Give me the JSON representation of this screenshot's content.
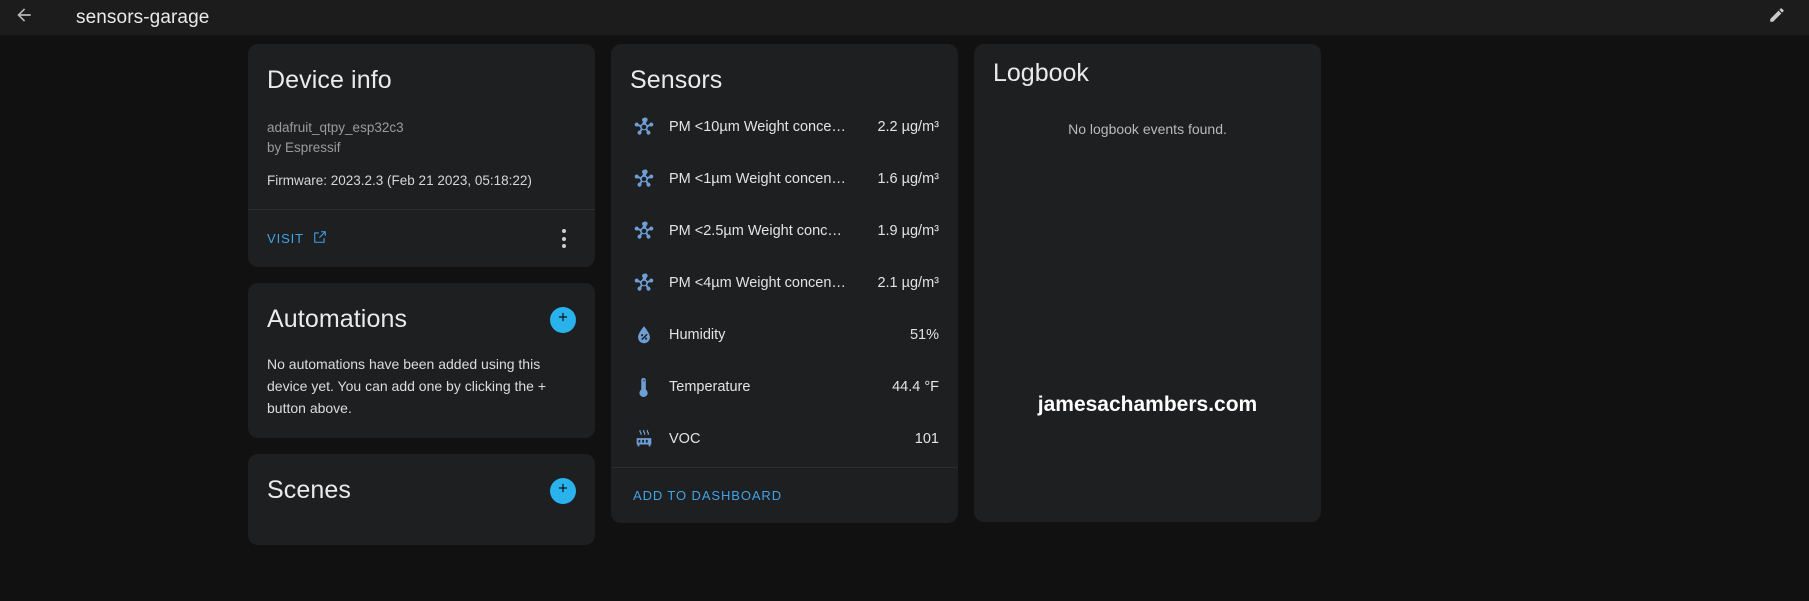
{
  "topbar": {
    "back_icon": "arrow-left-icon",
    "title": "sensors-garage",
    "edit_icon": "pencil-icon"
  },
  "device_info": {
    "title": "Device info",
    "model": "adafruit_qtpy_esp32c3",
    "manufacturer": "by Espressif",
    "firmware": "Firmware: 2023.2.3 (Feb 21 2023, 05:18:22)",
    "visit_label": "VISIT",
    "visit_icon": "external-link-icon",
    "menu_icon": "more-vert-icon"
  },
  "automations": {
    "title": "Automations",
    "add_icon": "plus-icon",
    "empty_text": "No automations have been added using this device yet. You can add one by clicking the + button above."
  },
  "scenes": {
    "title": "Scenes",
    "add_icon": "plus-icon"
  },
  "sensors": {
    "title": "Sensors",
    "rows": [
      {
        "icon": "molecule-icon",
        "name": "PM <10µm Weight conce…",
        "value": "2.2 µg/m³"
      },
      {
        "icon": "molecule-icon",
        "name": "PM <1µm Weight concen…",
        "value": "1.6 µg/m³"
      },
      {
        "icon": "molecule-icon",
        "name": "PM <2.5µm Weight conc…",
        "value": "1.9 µg/m³"
      },
      {
        "icon": "molecule-icon",
        "name": "PM <4µm Weight concen…",
        "value": "2.1 µg/m³"
      },
      {
        "icon": "water-percent-icon",
        "name": "Humidity",
        "value": "51%"
      },
      {
        "icon": "thermometer-icon",
        "name": "Temperature",
        "value": "44.4 °F"
      },
      {
        "icon": "radiator-icon",
        "name": "VOC",
        "value": "101"
      }
    ],
    "add_to_dashboard_label": "ADD TO DASHBOARD"
  },
  "logbook": {
    "title": "Logbook",
    "empty_text": "No logbook events found."
  },
  "watermark": "jamesachambers.com",
  "colors": {
    "accent": "#29b2ec",
    "link": "#3fa3e8",
    "sensor_icon": "#6e9ed4",
    "page_bg": "#111111",
    "card_bg": "#1e1f20",
    "topbar_bg": "#1c1c1c"
  }
}
